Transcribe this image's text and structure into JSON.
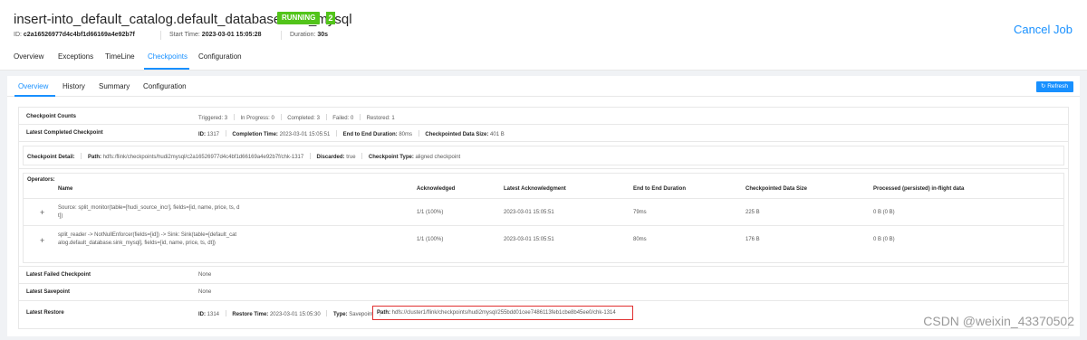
{
  "job": {
    "title": "insert-into_default_catalog.default_database.sink_mysql",
    "status": "RUNNING",
    "task_count": "2",
    "id_label": "ID:",
    "id_value": "c2a16526977d4c4bf1d66169a4e92b7f",
    "start_label": "Start Time:",
    "start_value": "2023-03-01 15:05:28",
    "duration_label": "Duration:",
    "duration_value": "30s",
    "cancel_label": "Cancel Job"
  },
  "main_tabs": [
    "Overview",
    "Exceptions",
    "TimeLine",
    "Checkpoints",
    "Configuration"
  ],
  "sub_tabs": [
    "Overview",
    "History",
    "Summary",
    "Configuration"
  ],
  "refresh_label": "Refresh",
  "counts": {
    "label": "Checkpoint Counts",
    "triggered_label": "Triggered:",
    "triggered": "3",
    "in_progress_label": "In Progress:",
    "in_progress": "0",
    "completed_label": "Completed:",
    "completed": "3",
    "failed_label": "Failed:",
    "failed": "0",
    "restored_label": "Restored:",
    "restored": "1"
  },
  "latest_completed": {
    "label": "Latest Completed Checkpoint",
    "id_label": "ID:",
    "id": "1317",
    "completion_label": "Completion Time:",
    "completion": "2023-03-01 15:05:51",
    "e2e_label": "End to End Duration:",
    "e2e": "80ms",
    "size_label": "Checkpointed Data Size:",
    "size": "401 B"
  },
  "detail": {
    "label": "Checkpoint Detail:",
    "path_label": "Path:",
    "path": "hdfs:/flink/checkpoints/hudi2mysql/c2a16526977d4c4bf1d66169a4e92b7f/chk-1317",
    "discarded_label": "Discarded:",
    "discarded": "true",
    "type_label": "Checkpoint Type:",
    "type": "aligned checkpoint"
  },
  "operators": {
    "label": "Operators:",
    "columns": [
      "Name",
      "Acknowledged",
      "Latest Acknowledgment",
      "End to End Duration",
      "Checkpointed Data Size",
      "Processed (persisted) in-flight data"
    ],
    "rows": [
      {
        "name_line1": "Source: split_monitor(table=[hudi_source_incr], fields=[id, name, price, ts, d",
        "name_line2": "t])",
        "acknowledged": "1/1 (100%)",
        "latest_ack": "2023-03-01 15:05:51",
        "e2e": "79ms",
        "size": "225 B",
        "processed": "0 B (0 B)"
      },
      {
        "name_line1": "split_reader -> NotNullEnforcer(fields=[id]) -> Sink: Sink(table=[default_cat",
        "name_line2": "alog.default_database.sink_mysql], fields=[id, name, price, ts, dt])",
        "acknowledged": "1/1 (100%)",
        "latest_ack": "2023-03-01 15:05:51",
        "e2e": "80ms",
        "size": "176 B",
        "processed": "0 B (0 B)"
      }
    ]
  },
  "latest_failed": {
    "label": "Latest Failed Checkpoint",
    "value": "None"
  },
  "latest_savepoint": {
    "label": "Latest Savepoint",
    "value": "None"
  },
  "latest_restore": {
    "label": "Latest Restore",
    "id_label": "ID:",
    "id": "1314",
    "restore_time_label": "Restore Time:",
    "restore_time": "2023-03-01 15:05:30",
    "type_label": "Type:",
    "type": "Savepoint",
    "path_label": "Path:",
    "path": "hdfs://cluster1/flink/checkpoints/hudi2mysql/255bdd01cee7486113feb1cbe8b45ee0/chk-1314"
  },
  "watermark": "CSDN @weixin_43370502",
  "colors": {
    "accent": "#1890ff",
    "running": "#52c41a",
    "highlight": "#e03030"
  }
}
